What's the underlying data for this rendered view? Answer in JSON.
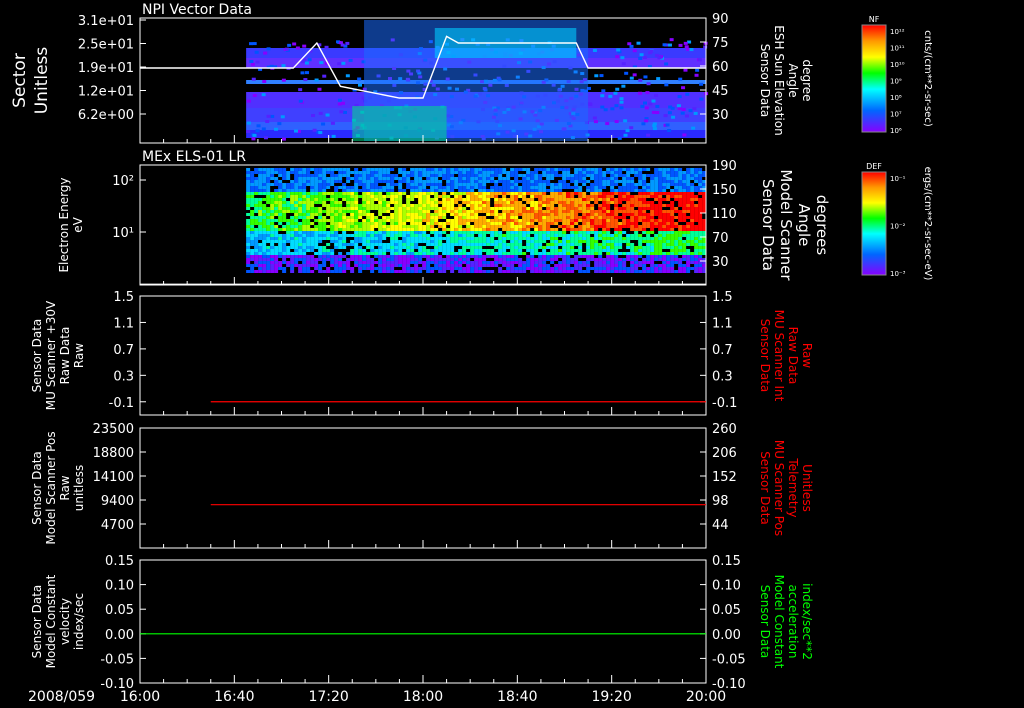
{
  "time_axis": {
    "date": "2008/059",
    "ticks": [
      "16:00",
      "16:40",
      "17:20",
      "18:00",
      "18:40",
      "19:20",
      "20:00"
    ]
  },
  "colorbars": [
    {
      "label": "NF",
      "unit": "cnts/(cm**2-sr-sec)",
      "ticks": [
        "10¹²",
        "10¹¹",
        "10¹⁰",
        "10⁹",
        "10⁸",
        "10⁷",
        "10⁶"
      ],
      "colors": [
        "#ff0000",
        "#ff9900",
        "#ffff00",
        "#00ff00",
        "#00ffff",
        "#0066ff",
        "#8800ff"
      ]
    },
    {
      "label": "DEF",
      "unit": "ergs/(cm**2-sr-sec-eV)",
      "ticks": [
        "10⁻¹",
        "10⁻²",
        "10⁻³"
      ],
      "colors": [
        "#ff0000",
        "#ff9900",
        "#ffff00",
        "#00ff00",
        "#00ffff",
        "#0066ff",
        "#8800ff"
      ]
    }
  ],
  "chart_data": [
    {
      "type": "heatmap",
      "title": "NPI Vector Data",
      "ylabel": "Sector\nUnitless",
      "yticks": [
        "3.1e+01",
        "2.5e+01",
        "1.9e+01",
        "1.2e+01",
        "6.2e+00"
      ],
      "y2label": "Sensor Data\nESH Sun Elevation\nAngle\ndegree",
      "y2ticks": [
        "90",
        "75",
        "60",
        "45",
        "30"
      ],
      "y2lim": [
        15,
        90
      ],
      "line": {
        "color": "#ffffff",
        "x": [
          "16:00",
          "17:05",
          "17:15",
          "17:25",
          "17:50",
          "18:00",
          "18:10",
          "18:15",
          "19:05",
          "19:10",
          "20:00"
        ],
        "y": [
          60,
          60,
          75,
          49,
          42,
          42,
          79,
          75,
          75,
          60,
          60
        ]
      }
    },
    {
      "type": "heatmap",
      "title": "MEx ELS-01 LR",
      "ylabel": "Electron Energy\neV",
      "yticks": [
        "10²",
        "10¹"
      ],
      "y2label": "Sensor Data\nModel Scanner\nAngle\ndegrees",
      "y2ticks": [
        "190",
        "150",
        "110",
        "70",
        "30"
      ],
      "y2lim": [
        10,
        190
      ],
      "line": {
        "color": "#ffffff",
        "x": [
          "16:00",
          "20:00"
        ],
        "y": [
          11,
          11
        ]
      }
    },
    {
      "type": "line",
      "ylabel": "Sensor Data\nMU Scanner +30V\nRaw Data\nRaw",
      "yticks": [
        "1.5",
        "1.1",
        "0.7",
        "0.3",
        "-0.1"
      ],
      "ylim": [
        -0.3,
        1.5
      ],
      "y2label": "Sensor Data\nMU Scanner Int\nRaw Data\nRaw",
      "y2ticks": [
        "1.5",
        "1.1",
        "0.7",
        "0.3",
        "-0.1"
      ],
      "y2color": "#ff0000",
      "series": [
        {
          "color": "#ff0000",
          "x": [
            "16:30",
            "20:00"
          ],
          "y": [
            -0.1,
            -0.1
          ]
        }
      ]
    },
    {
      "type": "line",
      "ylabel": "Sensor Data\nModel Scanner Pos\nRaw\nunitless",
      "yticks": [
        "23500",
        "18800",
        "14100",
        "9400",
        "4700"
      ],
      "ylim": [
        0,
        23500
      ],
      "y2label": "Sensor Data\nMU Scanner Pos\nTelemetry\nUnitless",
      "y2ticks": [
        "260",
        "206",
        "152",
        "98",
        "44"
      ],
      "y2color": "#ff0000",
      "series": [
        {
          "color": "#ff0000",
          "x": [
            "16:30",
            "20:00"
          ],
          "y": [
            8480,
            8480
          ]
        }
      ]
    },
    {
      "type": "line",
      "ylabel": "Sensor Data\nModel Constant\nvelocity\nindex/sec",
      "yticks": [
        "0.15",
        "0.10",
        "0.05",
        "0.00",
        "-0.05",
        "-0.10"
      ],
      "ylim": [
        -0.1,
        0.15
      ],
      "y2label": "Sensor Data\nModel Constant\nacceleration\nindex/sec**2",
      "y2ticks": [
        "0.15",
        "0.10",
        "0.05",
        "0.00",
        "-0.05",
        "-0.10"
      ],
      "y2color": "#00ff00",
      "series": [
        {
          "color": "#00ff00",
          "x": [
            "16:00",
            "20:00"
          ],
          "y": [
            0,
            0
          ]
        }
      ]
    }
  ]
}
